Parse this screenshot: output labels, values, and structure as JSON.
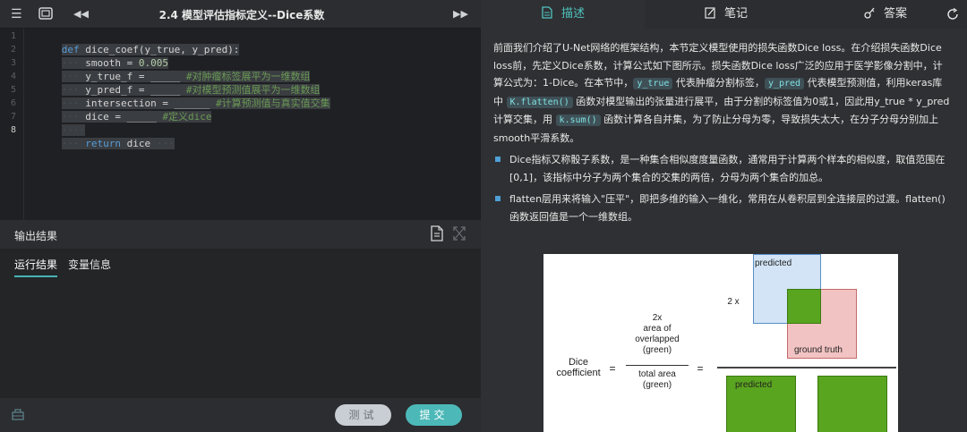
{
  "header": {
    "title": "2.4 模型评估指标定义--Dice系数"
  },
  "editor": {
    "line_numbers": [
      "1",
      "2",
      "3",
      "4",
      "5",
      "6",
      "7",
      "8"
    ],
    "code": {
      "l1_def": "def",
      "l1_rest": " dice_coef(y_true, y_pred):",
      "l2_a": "smooth = ",
      "l2_num": "0.005",
      "l3_a": "y_true_f = _____ ",
      "l3_cm": "#对肿瘤标签展平为一维数组",
      "l4_a": "y_pred_f = _____ ",
      "l4_cm": "#对模型预测值展平为一维数组",
      "l5_a": "intersection = ______ ",
      "l5_cm": "#计算预测值与真实值交集",
      "l6_a": "dice = _____ ",
      "l6_cm": "#定义dice",
      "l8_kw": "return",
      "l8_rest": " dice"
    }
  },
  "output": {
    "label": "输出结果",
    "tabs": [
      "运行结果",
      "变量信息"
    ]
  },
  "buttons": {
    "test": "测试",
    "submit": "提交"
  },
  "right_tabs": [
    "描述",
    "笔记",
    "答案"
  ],
  "description": {
    "p1_a": "前面我们介绍了U-Net网络的框架结构，本节定义模型使用的损失函数Dice loss。在介绍损失函数Dice loss前，先定义Dice系数，计算公式如下图所示。损失函数Dice loss广泛的应用于医学影像分割中，计算公式为：1-Dice。在本节中，",
    "chip_y_true": "y_true",
    "p1_b": " 代表肿瘤分割标签，",
    "chip_y_pred": "y_pred",
    "p1_c": " 代表模型预测值，利用keras库中 ",
    "chip_flatten": "K.flatten()",
    "p1_d": " 函数对模型输出的张量进行展平，由于分割的标签值为0或1，因此用y_true * y_pred 计算交集，用 ",
    "chip_sum": "k.sum()",
    "p1_e": " 函数计算各自并集，为了防止分母为零，导致损失太大，在分子分母分别加上smooth平滑系数。",
    "bullets": [
      "Dice指标又称骰子系数，是一种集合相似度度量函数，通常用于计算两个样本的相似度，取值范围在[0,1]，该指标中分子为两个集合的交集的两倍，分母为两个集合的加总。",
      "flatten层用来将输入\"压平\"，即把多维的输入一维化，常用在从卷积层到全连接层的过渡。flatten()函数返回值是一个一维数组。"
    ]
  },
  "figure": {
    "dice1": "Dice",
    "dice2": "coefficient",
    "eq": "=",
    "num1": "2x",
    "num2": "area of",
    "num3": "overlapped",
    "num4": "(green)",
    "den1": "total area",
    "den2": "(green)",
    "eq2": "=",
    "two_x": "2 x",
    "predicted_top": "predicted",
    "ground_truth": "ground truth",
    "predicted_bottom": "predicted"
  }
}
